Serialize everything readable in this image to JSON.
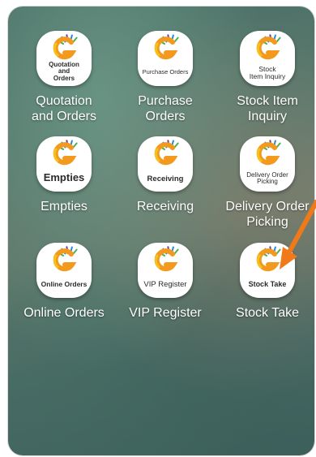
{
  "apps": [
    {
      "id": "quotation",
      "name": "quotation-and-orders",
      "label": "Quotation\nand Orders",
      "icon_text": "Quotation\nand\nOrders",
      "icon_size": "8px"
    },
    {
      "id": "purchase",
      "name": "purchase-orders",
      "label": "Purchase\nOrders",
      "icon_text": "Purchase Orders",
      "icon_size": "7.5px"
    },
    {
      "id": "stock_inquiry",
      "name": "stock-item-inquiry",
      "label": "Stock Item\nInquiry",
      "icon_text": "Stock\nItem Inquiry",
      "icon_size": "8.5px"
    },
    {
      "id": "empties",
      "name": "empties",
      "label": "Empties",
      "icon_text": "Empties",
      "icon_size": "13px"
    },
    {
      "id": "receiving",
      "name": "receiving",
      "label": "Receiving",
      "icon_text": "Receiving",
      "icon_size": "9.5px"
    },
    {
      "id": "delivery",
      "name": "delivery-order-picking",
      "label": "Delivery Order\nPicking",
      "icon_text": "Delivery Order\nPicking",
      "icon_size": "8px"
    },
    {
      "id": "online",
      "name": "online-orders",
      "label": "Online Orders",
      "icon_text": "Online Orders",
      "icon_size": "8.5px"
    },
    {
      "id": "vip",
      "name": "vip-register",
      "label": "VIP Register",
      "icon_text": "VIP Register",
      "icon_size": "9.5px"
    },
    {
      "id": "stocktake",
      "name": "stock-take",
      "label": "Stock Take",
      "icon_text": "Stock Take",
      "icon_size": "9px"
    }
  ],
  "colors": {
    "logo_orange": "#f39a1e",
    "logo_yellow": "#f5c21b",
    "logo_green": "#4caf50",
    "logo_blue": "#1e88e5",
    "logo_purple": "#6a3fa0",
    "arrow": "#f07a1a"
  }
}
